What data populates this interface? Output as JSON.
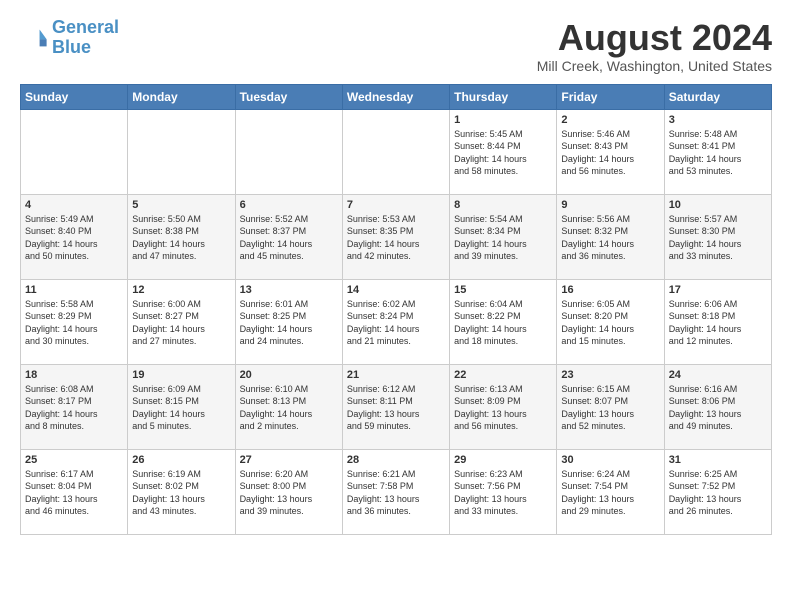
{
  "header": {
    "logo_line1": "General",
    "logo_line2": "Blue",
    "month_title": "August 2024",
    "location": "Mill Creek, Washington, United States"
  },
  "days_of_week": [
    "Sunday",
    "Monday",
    "Tuesday",
    "Wednesday",
    "Thursday",
    "Friday",
    "Saturday"
  ],
  "weeks": [
    [
      {
        "day": "",
        "info": ""
      },
      {
        "day": "",
        "info": ""
      },
      {
        "day": "",
        "info": ""
      },
      {
        "day": "",
        "info": ""
      },
      {
        "day": "1",
        "info": "Sunrise: 5:45 AM\nSunset: 8:44 PM\nDaylight: 14 hours\nand 58 minutes."
      },
      {
        "day": "2",
        "info": "Sunrise: 5:46 AM\nSunset: 8:43 PM\nDaylight: 14 hours\nand 56 minutes."
      },
      {
        "day": "3",
        "info": "Sunrise: 5:48 AM\nSunset: 8:41 PM\nDaylight: 14 hours\nand 53 minutes."
      }
    ],
    [
      {
        "day": "4",
        "info": "Sunrise: 5:49 AM\nSunset: 8:40 PM\nDaylight: 14 hours\nand 50 minutes."
      },
      {
        "day": "5",
        "info": "Sunrise: 5:50 AM\nSunset: 8:38 PM\nDaylight: 14 hours\nand 47 minutes."
      },
      {
        "day": "6",
        "info": "Sunrise: 5:52 AM\nSunset: 8:37 PM\nDaylight: 14 hours\nand 45 minutes."
      },
      {
        "day": "7",
        "info": "Sunrise: 5:53 AM\nSunset: 8:35 PM\nDaylight: 14 hours\nand 42 minutes."
      },
      {
        "day": "8",
        "info": "Sunrise: 5:54 AM\nSunset: 8:34 PM\nDaylight: 14 hours\nand 39 minutes."
      },
      {
        "day": "9",
        "info": "Sunrise: 5:56 AM\nSunset: 8:32 PM\nDaylight: 14 hours\nand 36 minutes."
      },
      {
        "day": "10",
        "info": "Sunrise: 5:57 AM\nSunset: 8:30 PM\nDaylight: 14 hours\nand 33 minutes."
      }
    ],
    [
      {
        "day": "11",
        "info": "Sunrise: 5:58 AM\nSunset: 8:29 PM\nDaylight: 14 hours\nand 30 minutes."
      },
      {
        "day": "12",
        "info": "Sunrise: 6:00 AM\nSunset: 8:27 PM\nDaylight: 14 hours\nand 27 minutes."
      },
      {
        "day": "13",
        "info": "Sunrise: 6:01 AM\nSunset: 8:25 PM\nDaylight: 14 hours\nand 24 minutes."
      },
      {
        "day": "14",
        "info": "Sunrise: 6:02 AM\nSunset: 8:24 PM\nDaylight: 14 hours\nand 21 minutes."
      },
      {
        "day": "15",
        "info": "Sunrise: 6:04 AM\nSunset: 8:22 PM\nDaylight: 14 hours\nand 18 minutes."
      },
      {
        "day": "16",
        "info": "Sunrise: 6:05 AM\nSunset: 8:20 PM\nDaylight: 14 hours\nand 15 minutes."
      },
      {
        "day": "17",
        "info": "Sunrise: 6:06 AM\nSunset: 8:18 PM\nDaylight: 14 hours\nand 12 minutes."
      }
    ],
    [
      {
        "day": "18",
        "info": "Sunrise: 6:08 AM\nSunset: 8:17 PM\nDaylight: 14 hours\nand 8 minutes."
      },
      {
        "day": "19",
        "info": "Sunrise: 6:09 AM\nSunset: 8:15 PM\nDaylight: 14 hours\nand 5 minutes."
      },
      {
        "day": "20",
        "info": "Sunrise: 6:10 AM\nSunset: 8:13 PM\nDaylight: 14 hours\nand 2 minutes."
      },
      {
        "day": "21",
        "info": "Sunrise: 6:12 AM\nSunset: 8:11 PM\nDaylight: 13 hours\nand 59 minutes."
      },
      {
        "day": "22",
        "info": "Sunrise: 6:13 AM\nSunset: 8:09 PM\nDaylight: 13 hours\nand 56 minutes."
      },
      {
        "day": "23",
        "info": "Sunrise: 6:15 AM\nSunset: 8:07 PM\nDaylight: 13 hours\nand 52 minutes."
      },
      {
        "day": "24",
        "info": "Sunrise: 6:16 AM\nSunset: 8:06 PM\nDaylight: 13 hours\nand 49 minutes."
      }
    ],
    [
      {
        "day": "25",
        "info": "Sunrise: 6:17 AM\nSunset: 8:04 PM\nDaylight: 13 hours\nand 46 minutes."
      },
      {
        "day": "26",
        "info": "Sunrise: 6:19 AM\nSunset: 8:02 PM\nDaylight: 13 hours\nand 43 minutes."
      },
      {
        "day": "27",
        "info": "Sunrise: 6:20 AM\nSunset: 8:00 PM\nDaylight: 13 hours\nand 39 minutes."
      },
      {
        "day": "28",
        "info": "Sunrise: 6:21 AM\nSunset: 7:58 PM\nDaylight: 13 hours\nand 36 minutes."
      },
      {
        "day": "29",
        "info": "Sunrise: 6:23 AM\nSunset: 7:56 PM\nDaylight: 13 hours\nand 33 minutes."
      },
      {
        "day": "30",
        "info": "Sunrise: 6:24 AM\nSunset: 7:54 PM\nDaylight: 13 hours\nand 29 minutes."
      },
      {
        "day": "31",
        "info": "Sunrise: 6:25 AM\nSunset: 7:52 PM\nDaylight: 13 hours\nand 26 minutes."
      }
    ]
  ]
}
